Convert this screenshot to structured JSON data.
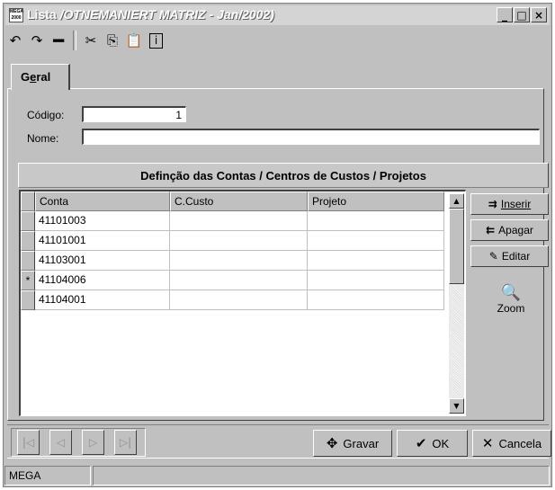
{
  "window": {
    "icon_text": "MEGA 2000",
    "title_prefix": "Lista",
    "title_detail": "/OTNEMANIERT MATRIZ - Jan/2002)",
    "minimize": "_",
    "maximize": "□",
    "close": "×"
  },
  "toolbar": {
    "icons": [
      "undo-icon",
      "redo-icon",
      "delete-icon",
      "cut-icon",
      "copy-icon",
      "paste-icon",
      "info-icon"
    ]
  },
  "tabs": [
    {
      "label": "Geral",
      "mnemonic": "e"
    }
  ],
  "form": {
    "codigo_label": "Código:",
    "codigo_value": "1",
    "nome_label": "Nome:",
    "nome_value": ""
  },
  "group": {
    "title": "Definção das Contas / Centros de Custos / Projetos"
  },
  "grid": {
    "columns": [
      "Conta",
      "C.Custo",
      "Projeto"
    ],
    "rows": [
      {
        "indicator": "",
        "conta": "41101003",
        "ccusto": "",
        "projeto": ""
      },
      {
        "indicator": "",
        "conta": "41101001",
        "ccusto": "",
        "projeto": ""
      },
      {
        "indicator": "",
        "conta": "41103001",
        "ccusto": "",
        "projeto": ""
      },
      {
        "indicator": "*",
        "conta": "41104006",
        "ccusto": "",
        "projeto": ""
      },
      {
        "indicator": "",
        "conta": "41104001",
        "ccusto": "",
        "projeto": ""
      }
    ]
  },
  "side_buttons": {
    "inserir": "Inserir",
    "apagar": "Apagar",
    "editar": "Editar",
    "zoom": "Zoom"
  },
  "navigation": [
    "first-record-icon",
    "prev-record-icon",
    "next-record-icon",
    "last-record-icon"
  ],
  "actions": {
    "gravar": "Gravar",
    "ok": "OK",
    "cancela": "Cancela"
  },
  "status": {
    "panel1": "MEGA",
    "panel2": ""
  }
}
